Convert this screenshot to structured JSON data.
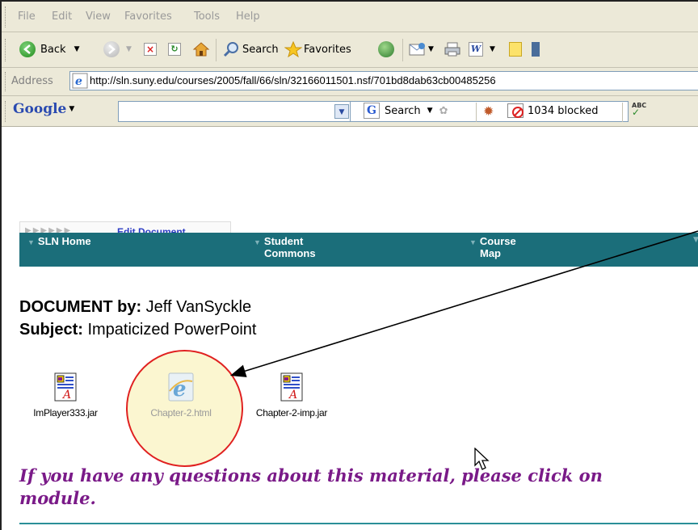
{
  "menu": [
    "File",
    "Edit",
    "View",
    "Favorites",
    "Tools",
    "Help"
  ],
  "toolbar": {
    "back_label": "Back",
    "search_label": "Search",
    "favorites_label": "Favorites"
  },
  "address": {
    "label": "Address",
    "url": "http://sln.suny.edu/courses/2005/fall/66/sln/32166011501.nsf/701bd8dab63cb00485256"
  },
  "googlebar": {
    "logo": "Google",
    "search_label": "Search",
    "blocked_label": "1034 blocked"
  },
  "page": {
    "edit_document": "Edit Document",
    "nav": {
      "home": "SLN Home",
      "student_line1": "Student",
      "student_line2": "Commons",
      "course_line1": "Course",
      "course_line2": "Map"
    },
    "doc_label": "DOCUMENT by:",
    "author": "Jeff VanSyckle",
    "subject_label": "Subject:",
    "subject": "Impaticized PowerPoint",
    "attachments": [
      {
        "name": "ImPlayer333.jar",
        "icon": "jar-file-icon"
      },
      {
        "name": "Chapter-2.html",
        "icon": "ie-html-icon"
      },
      {
        "name": "Chapter-2-imp.jar",
        "icon": "jar-file-icon"
      }
    ],
    "question_line1": "If you have any questions about this material, please click on",
    "question_line2": "module."
  },
  "colors": {
    "nav_bg": "#1b6e7a",
    "question": "#7a1a88",
    "highlight_circle": "#e02020",
    "highlight_fill": "#fbf6d0"
  }
}
